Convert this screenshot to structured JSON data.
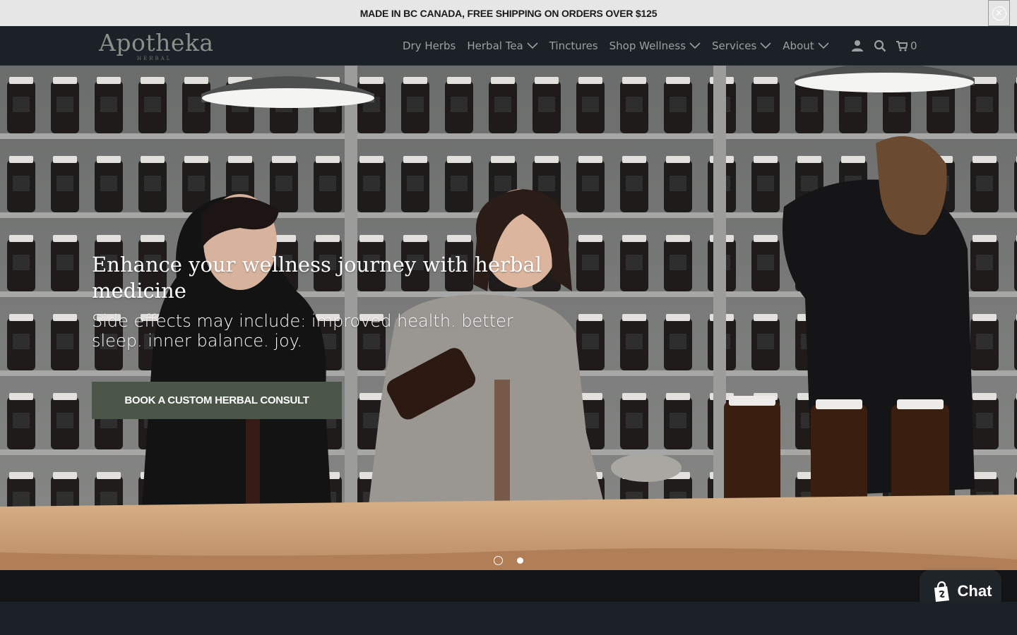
{
  "announcement": {
    "text": "MADE IN BC CANADA, FREE SHIPPING ON ORDERS OVER $125",
    "close_icon": "close-icon"
  },
  "brand": {
    "logo_text": "Apotheka",
    "logo_subtext": "HERBAL"
  },
  "nav": {
    "items": [
      {
        "label": "Dry Herbs",
        "has_dropdown": false
      },
      {
        "label": "Herbal Tea",
        "has_dropdown": true
      },
      {
        "label": "Tinctures",
        "has_dropdown": false
      },
      {
        "label": "Shop Wellness",
        "has_dropdown": true
      },
      {
        "label": "Services",
        "has_dropdown": true
      },
      {
        "label": "About",
        "has_dropdown": true
      }
    ],
    "icons": [
      "account-icon",
      "search-icon",
      "cart-icon"
    ],
    "cart_count": "0"
  },
  "hero": {
    "title": "Enhance your wellness journey with herbal medicine",
    "subtitle": "Side effects may include: improved health. better sleep. inner balance. joy.",
    "cta_label": "BOOK A CUSTOM HERBAL CONSULT",
    "slides_total": 2,
    "active_slide": 1
  },
  "chat": {
    "label": "Chat",
    "icon": "shopify-bag-icon"
  },
  "colors": {
    "header_bg": "#1c2027",
    "announcement_bg": "#e6e6e6",
    "cta_bg": "#4b5648",
    "nav_text": "#9da09f",
    "chat_bg": "#1f2428"
  }
}
